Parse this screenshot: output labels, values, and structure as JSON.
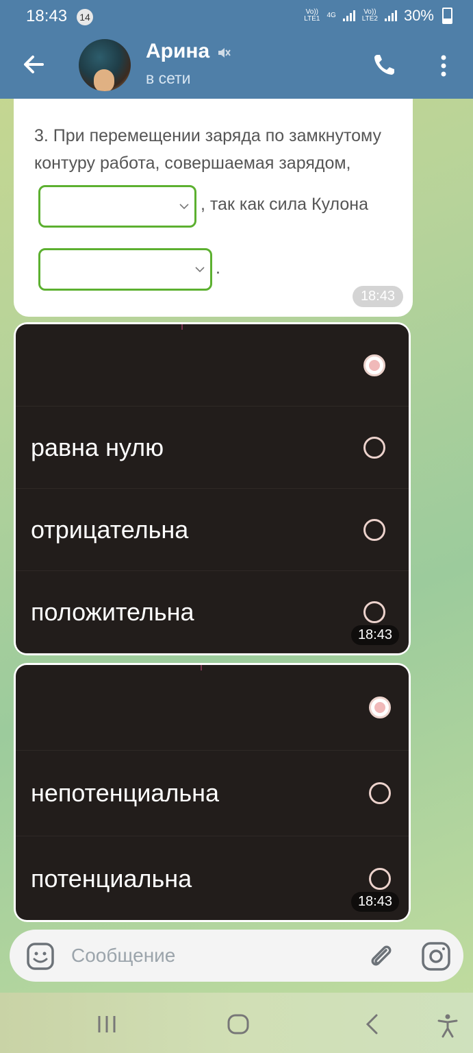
{
  "status_bar": {
    "time": "18:43",
    "notification_count": "14",
    "network1": "Vo))\nLTE1",
    "network_4g": "4G",
    "network2": "Vo))\nLTE2",
    "battery": "30%"
  },
  "header": {
    "contact_name": "Арина",
    "status": "в сети"
  },
  "message1": {
    "question_text": "3. При перемещении заряда по замкнутому контуру работа, совершаемая зарядом,",
    "text_after_select1": ", так как сила Кулона",
    "text_after_select2": ".",
    "time": "18:43"
  },
  "message2": {
    "options": [
      "",
      "равна нулю",
      "отрицательна",
      "положительна"
    ],
    "selected_index": 0,
    "time": "18:43"
  },
  "message3": {
    "options": [
      "",
      "непотенциальна",
      "потенциальна"
    ],
    "selected_index": 0,
    "time": "18:43"
  },
  "input": {
    "placeholder": "Сообщение"
  },
  "colors": {
    "header": "#4f7fa8",
    "select_border": "#5cb030",
    "dark_bubble": "#221d1b"
  }
}
